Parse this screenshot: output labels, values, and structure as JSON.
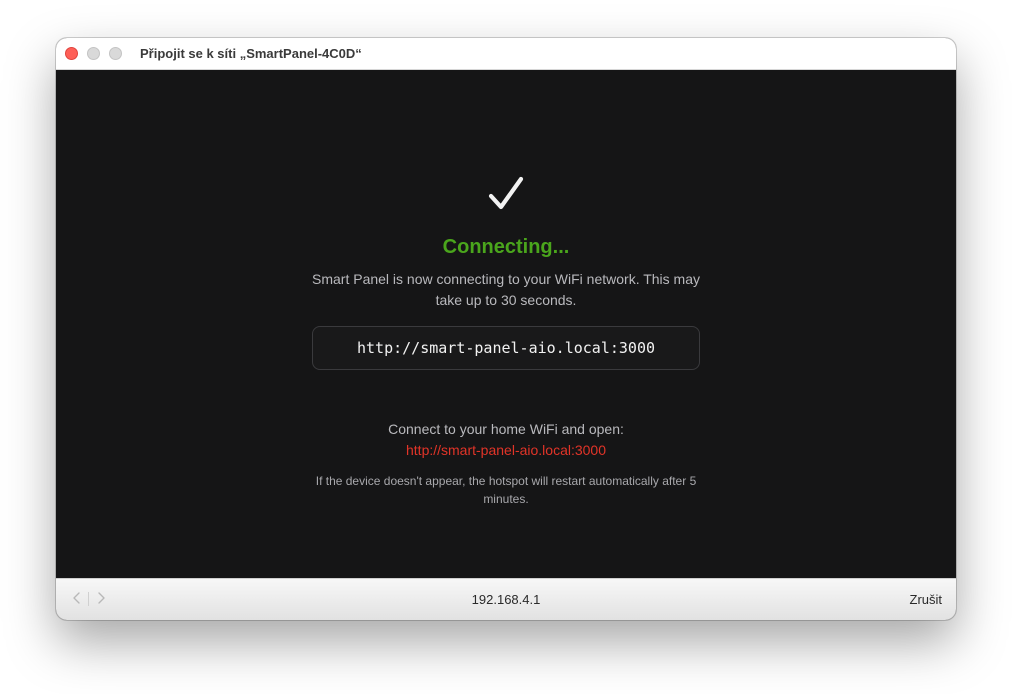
{
  "window": {
    "title": "Připojit se k síti „SmartPanel-4C0D“"
  },
  "content": {
    "icon": "checkmark-icon",
    "status_title": "Connecting...",
    "message": "Smart Panel is now connecting to your WiFi network. This may take up to 30 seconds.",
    "url_box": "http://smart-panel-aio.local:3000",
    "connect_label": "Connect to your home WiFi and open:",
    "connect_link": "http://smart-panel-aio.local:3000",
    "note": "If the device doesn't appear, the hotspot will restart automatically after 5 minutes."
  },
  "bottombar": {
    "address": "192.168.4.1",
    "cancel_label": "Zrušit"
  },
  "colors": {
    "status": "#4aa51c",
    "link": "#e23428",
    "background": "#151516"
  }
}
